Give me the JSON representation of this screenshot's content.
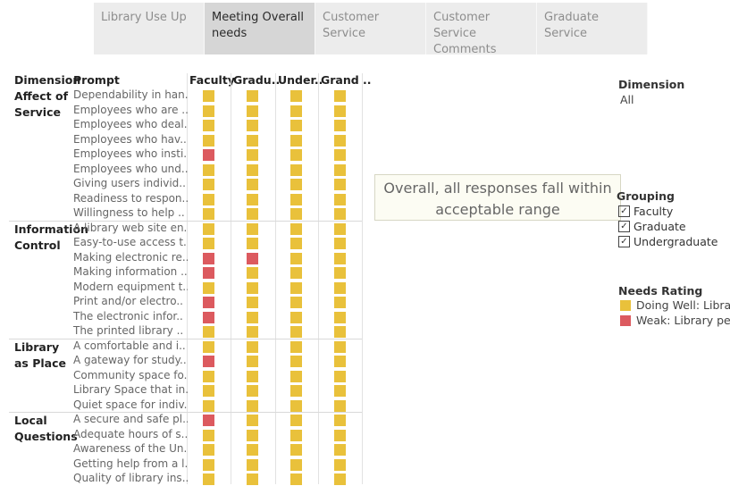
{
  "tabs": [
    {
      "label": "Library Use Up",
      "active": false
    },
    {
      "label": "Meeting Overall needs",
      "active": true
    },
    {
      "label": "Customer Service",
      "active": false
    },
    {
      "label": "Customer Service Comments",
      "active": false
    },
    {
      "label": "Graduate Service",
      "active": false
    }
  ],
  "table": {
    "headers": {
      "dimension": "Dimension",
      "prompt": "Prompt",
      "faculty": "Faculty",
      "graduate": "Gradu..",
      "undergraduate": "Under..",
      "grand": "Grand .."
    },
    "groups": [
      {
        "name": "Affect of Service",
        "rows": [
          {
            "prompt": "Dependability in han..",
            "ratings": [
              "Y",
              "Y",
              "Y",
              "Y"
            ]
          },
          {
            "prompt": "Employees who are ..",
            "ratings": [
              "Y",
              "Y",
              "Y",
              "Y"
            ]
          },
          {
            "prompt": "Employees who deal..",
            "ratings": [
              "Y",
              "Y",
              "Y",
              "Y"
            ]
          },
          {
            "prompt": "Employees who hav..",
            "ratings": [
              "Y",
              "Y",
              "Y",
              "Y"
            ]
          },
          {
            "prompt": "Employees who insti..",
            "ratings": [
              "R",
              "Y",
              "Y",
              "Y"
            ]
          },
          {
            "prompt": "Employees who und..",
            "ratings": [
              "Y",
              "Y",
              "Y",
              "Y"
            ]
          },
          {
            "prompt": "Giving users individ..",
            "ratings": [
              "Y",
              "Y",
              "Y",
              "Y"
            ]
          },
          {
            "prompt": "Readiness to respon..",
            "ratings": [
              "Y",
              "Y",
              "Y",
              "Y"
            ]
          },
          {
            "prompt": "Willingness to help ..",
            "ratings": [
              "Y",
              "Y",
              "Y",
              "Y"
            ]
          }
        ]
      },
      {
        "name": "Information Control",
        "rows": [
          {
            "prompt": "A library web site en..",
            "ratings": [
              "Y",
              "Y",
              "Y",
              "Y"
            ]
          },
          {
            "prompt": "Easy-to-use access t..",
            "ratings": [
              "Y",
              "Y",
              "Y",
              "Y"
            ]
          },
          {
            "prompt": "Making electronic re..",
            "ratings": [
              "R",
              "R",
              "Y",
              "Y"
            ]
          },
          {
            "prompt": "Making information ..",
            "ratings": [
              "R",
              "Y",
              "Y",
              "Y"
            ]
          },
          {
            "prompt": "Modern equipment t..",
            "ratings": [
              "Y",
              "Y",
              "Y",
              "Y"
            ]
          },
          {
            "prompt": "Print and/or electro..",
            "ratings": [
              "R",
              "Y",
              "Y",
              "Y"
            ]
          },
          {
            "prompt": "The electronic infor..",
            "ratings": [
              "R",
              "Y",
              "Y",
              "Y"
            ]
          },
          {
            "prompt": "The printed library ..",
            "ratings": [
              "Y",
              "Y",
              "Y",
              "Y"
            ]
          }
        ]
      },
      {
        "name": "Library as Place",
        "rows": [
          {
            "prompt": "A comfortable and i..",
            "ratings": [
              "Y",
              "Y",
              "Y",
              "Y"
            ]
          },
          {
            "prompt": "A gateway for study..",
            "ratings": [
              "R",
              "Y",
              "Y",
              "Y"
            ]
          },
          {
            "prompt": "Community space fo..",
            "ratings": [
              "Y",
              "Y",
              "Y",
              "Y"
            ]
          },
          {
            "prompt": "Library Space that in..",
            "ratings": [
              "Y",
              "Y",
              "Y",
              "Y"
            ]
          },
          {
            "prompt": "Quiet space for indiv..",
            "ratings": [
              "Y",
              "Y",
              "Y",
              "Y"
            ]
          }
        ]
      },
      {
        "name": "Local Questions",
        "rows": [
          {
            "prompt": "A secure and safe pl..",
            "ratings": [
              "R",
              "Y",
              "Y",
              "Y"
            ]
          },
          {
            "prompt": "Adequate hours of s..",
            "ratings": [
              "Y",
              "Y",
              "Y",
              "Y"
            ]
          },
          {
            "prompt": "Awareness of the Un..",
            "ratings": [
              "Y",
              "Y",
              "Y",
              "Y"
            ]
          },
          {
            "prompt": "Getting help from a l..",
            "ratings": [
              "Y",
              "Y",
              "Y",
              "Y"
            ]
          },
          {
            "prompt": "Quality of library ins..",
            "ratings": [
              "Y",
              "Y",
              "Y",
              "Y"
            ]
          }
        ]
      }
    ]
  },
  "colors": {
    "doing_well": "#e9c13b",
    "weak": "#dc5a5f"
  },
  "callout": {
    "text": "Overall, all responses fall within acceptable range"
  },
  "filters": {
    "dimension": {
      "title": "Dimension",
      "value": "All"
    },
    "grouping": {
      "title": "Grouping",
      "options": [
        {
          "label": "Faculty",
          "checked": true
        },
        {
          "label": "Graduate",
          "checked": true
        },
        {
          "label": "Undergraduate",
          "checked": true
        }
      ]
    }
  },
  "legend": {
    "title": "Needs Rating",
    "items": [
      {
        "label": "Doing Well: Libra..",
        "color": "#e9c13b"
      },
      {
        "label": "Weak: Library pe..",
        "color": "#dc5a5f"
      }
    ]
  }
}
